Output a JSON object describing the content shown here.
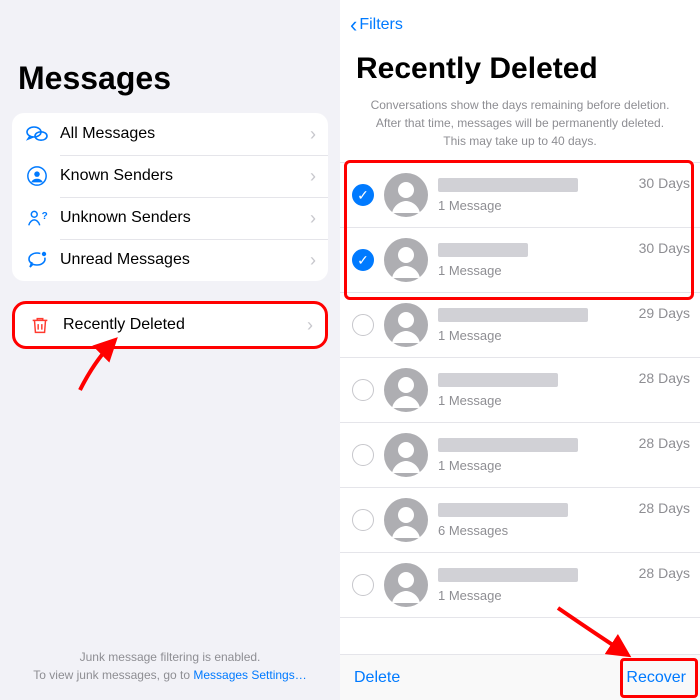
{
  "left": {
    "title": "Messages",
    "items": [
      {
        "label": "All Messages",
        "icon": "chat-bubbles-icon"
      },
      {
        "label": "Known Senders",
        "icon": "person-circle-icon"
      },
      {
        "label": "Unknown Senders",
        "icon": "person-question-icon"
      },
      {
        "label": "Unread Messages",
        "icon": "unread-bubble-icon"
      }
    ],
    "deleted_item": {
      "label": "Recently Deleted",
      "icon": "trash-icon"
    },
    "footer_line1": "Junk message filtering is enabled.",
    "footer_line2_pre": "To view junk messages, go to ",
    "footer_link": "Messages Settings…"
  },
  "right": {
    "back_label": "Filters",
    "title": "Recently Deleted",
    "sub1": "Conversations show the days remaining before deletion.",
    "sub2": "After that time, messages will be permanently deleted.",
    "sub3": "This may take up to 40 days.",
    "rows": [
      {
        "selected": true,
        "messages": "1 Message",
        "days": "30 Days",
        "name_w": 140
      },
      {
        "selected": true,
        "messages": "1 Message",
        "days": "30 Days",
        "name_w": 90
      },
      {
        "selected": false,
        "messages": "1 Message",
        "days": "29 Days",
        "name_w": 150
      },
      {
        "selected": false,
        "messages": "1 Message",
        "days": "28 Days",
        "name_w": 120
      },
      {
        "selected": false,
        "messages": "1 Message",
        "days": "28 Days",
        "name_w": 140
      },
      {
        "selected": false,
        "messages": "6 Messages",
        "days": "28 Days",
        "name_w": 130
      },
      {
        "selected": false,
        "messages": "1 Message",
        "days": "28 Days",
        "name_w": 140
      }
    ],
    "delete_label": "Delete",
    "recover_label": "Recover"
  },
  "colors": {
    "ios_blue": "#007aff",
    "ios_red": "#ff3b30",
    "annot_red": "#ff0000"
  }
}
